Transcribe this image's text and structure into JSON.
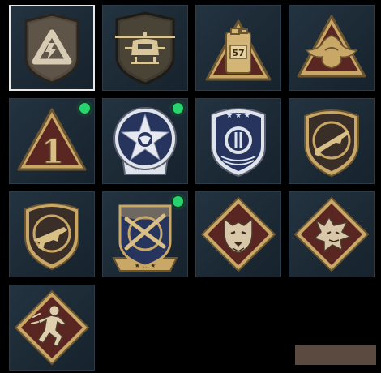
{
  "emblems": [
    {
      "icon": "lightning-triangle-shield-icon",
      "selected": true,
      "is_new": false
    },
    {
      "icon": "helicopter-shield-icon",
      "selected": false,
      "is_new": false
    },
    {
      "icon": "jerrycan-triangle-icon",
      "selected": false,
      "is_new": false,
      "text": "57"
    },
    {
      "icon": "eagle-triangle-icon",
      "selected": false,
      "is_new": false
    },
    {
      "icon": "number-one-triangle-icon",
      "selected": false,
      "is_new": true,
      "text": "1"
    },
    {
      "icon": "star-eagle-roundel-icon",
      "selected": false,
      "is_new": true
    },
    {
      "icon": "police-badge-icon",
      "selected": false,
      "is_new": false
    },
    {
      "icon": "rifle-shield-icon",
      "selected": false,
      "is_new": false
    },
    {
      "icon": "smg-shield-icon",
      "selected": false,
      "is_new": false
    },
    {
      "icon": "crossed-rifles-crest-icon",
      "selected": false,
      "is_new": true
    },
    {
      "icon": "wolf-diamond-icon",
      "selected": false,
      "is_new": false
    },
    {
      "icon": "dragon-diamond-icon",
      "selected": false,
      "is_new": false
    },
    {
      "icon": "running-figure-diamond-icon",
      "selected": false,
      "is_new": false
    }
  ],
  "colors": {
    "tile_bg": "#1c2a35",
    "selected_border": "#e8e8e8",
    "new_indicator": "#28d46e",
    "gold": "#c9a867",
    "dark_red": "#5a2622",
    "navy": "#26345e",
    "swatch": "#5a4a40"
  }
}
